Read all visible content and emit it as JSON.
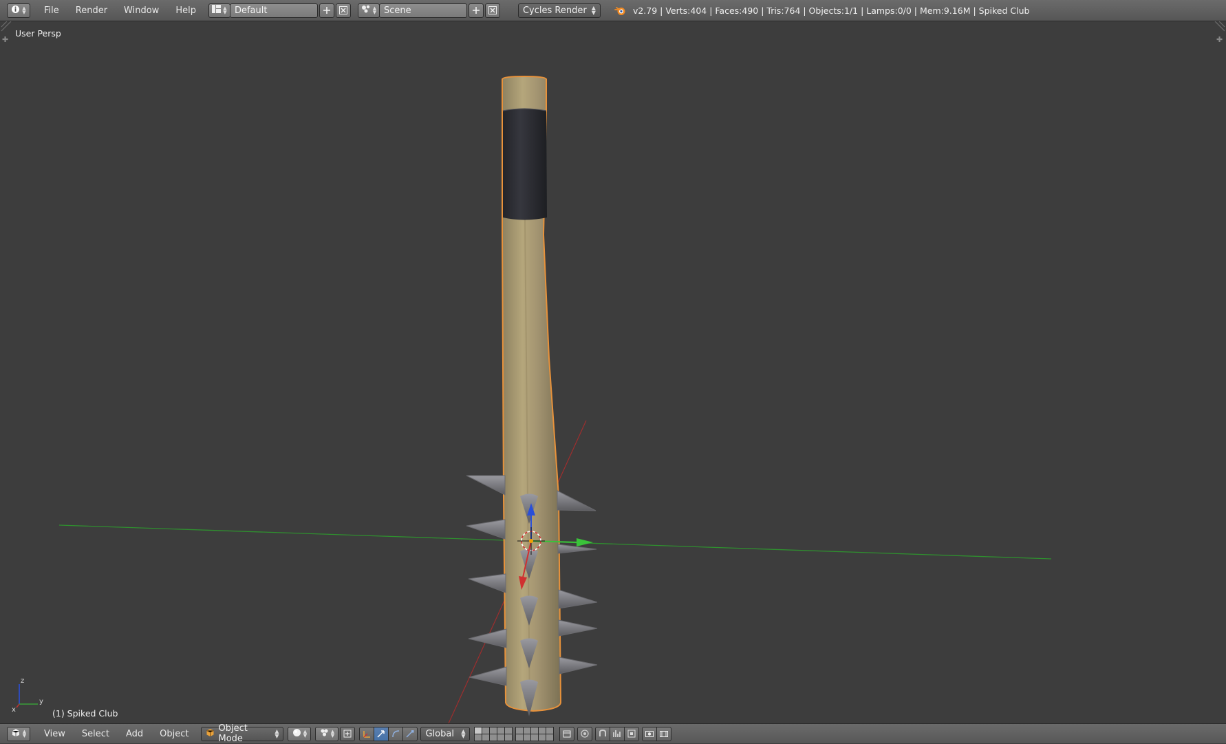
{
  "top_bar": {
    "editor_icon": "info-icon",
    "menus": [
      "File",
      "Render",
      "Window",
      "Help"
    ],
    "layout": {
      "icon": "screen-layout-icon",
      "value": "Default"
    },
    "scene": {
      "icon": "scene-icon",
      "value": "Scene"
    },
    "render_engine": "Cycles Render",
    "blender_logo": "blender-logo-icon",
    "stats": "v2.79 | Verts:404 | Faces:490 | Tris:764 | Objects:1/1 | Lamps:0/0 | Mem:9.16M | Spiked Club"
  },
  "viewport": {
    "view_name": "User Persp",
    "object_label": "(1) Spiked Club",
    "axis_labels": {
      "x": "x",
      "y": "y",
      "z": "z"
    },
    "colors": {
      "background": "#3d3d3d",
      "wood": "#a89a70",
      "grip": "#2a2b31",
      "spike": "#7d7d80",
      "selection_outline": "#e8923b",
      "axis_x": "#b83434",
      "axis_y": "#3a9e3a",
      "axis_z": "#2a4fd8"
    }
  },
  "bottom_bar": {
    "editor_icon": "3d-view-icon",
    "menus": [
      "View",
      "Select",
      "Add",
      "Object"
    ],
    "mode": {
      "icon": "object-mode-cube-icon",
      "value": "Object Mode"
    },
    "shading_icon": "viewport-shading-solid-icon",
    "pivot_icon": "pivot-point-icon",
    "manipulator_icons": [
      "manipulator-toggle-icon",
      "translate-icon",
      "rotate-icon",
      "scale-icon"
    ],
    "orientation": "Global",
    "layers_icon": "scene-layers",
    "right_icons": [
      "lock-layers-icon",
      "proportional-edit-icon",
      "snap-icon",
      "snap-element-icon",
      "opengl-render-icon",
      "opengl-anim-icon"
    ]
  }
}
